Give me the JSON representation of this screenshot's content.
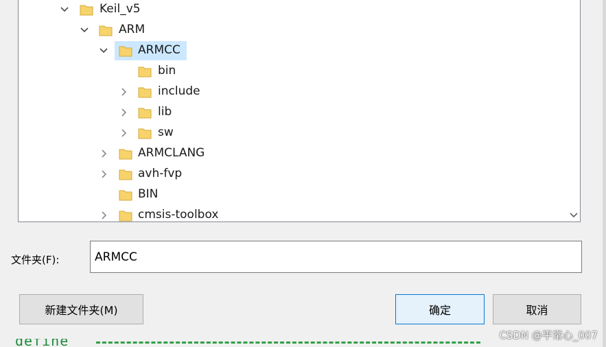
{
  "tree": {
    "items": [
      {
        "label": "Keil_v5",
        "expander": "expanded"
      },
      {
        "label": "ARM",
        "expander": "expanded"
      },
      {
        "label": "ARMCC",
        "expander": "expanded",
        "selected": true
      },
      {
        "label": "bin",
        "expander": "none"
      },
      {
        "label": "include",
        "expander": "collapsed"
      },
      {
        "label": "lib",
        "expander": "collapsed"
      },
      {
        "label": "sw",
        "expander": "collapsed"
      },
      {
        "label": "ARMCLANG",
        "expander": "collapsed"
      },
      {
        "label": "avh-fvp",
        "expander": "collapsed"
      },
      {
        "label": "BIN",
        "expander": "none"
      },
      {
        "label": "cmsis-toolbox",
        "expander": "collapsed"
      }
    ],
    "folder_icon": "folder-icon",
    "folder_color": "#f7d36c"
  },
  "folder_field": {
    "label": "文件夹(F):",
    "value": "ARMCC"
  },
  "buttons": {
    "new_folder": "新建文件夹(M)",
    "ok": "确定",
    "cancel": "取消"
  },
  "background_code": "define",
  "watermark": "CSDN @平常心_007"
}
